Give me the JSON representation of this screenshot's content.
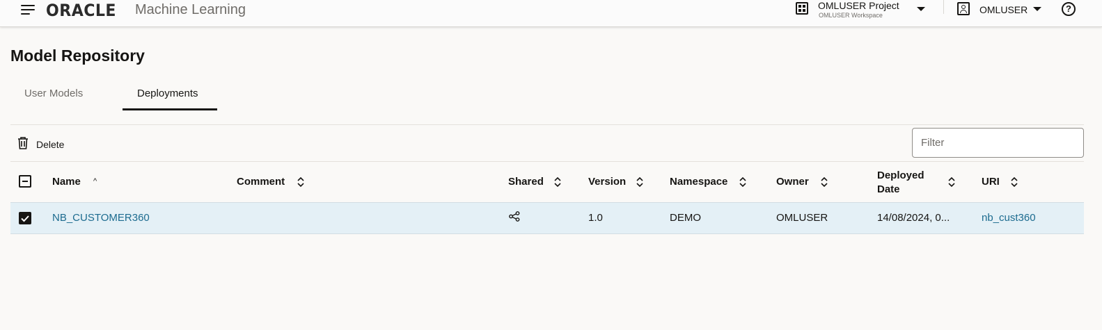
{
  "header": {
    "logo": "ORACLE",
    "app_name": "Machine Learning",
    "project_title": "OMLUSER Project",
    "project_subtitle": "OMLUSER Workspace",
    "user_name": "OMLUSER",
    "help_label": "?"
  },
  "page": {
    "title": "Model Repository",
    "tabs": [
      {
        "label": "User Models",
        "selected": false
      },
      {
        "label": "Deployments",
        "selected": true
      }
    ]
  },
  "toolbar": {
    "delete_label": "Delete",
    "filter_placeholder": "Filter",
    "filter_value": ""
  },
  "table": {
    "columns": [
      {
        "label": "Name",
        "sort": "ascending"
      },
      {
        "label": "Comment",
        "sort": "none"
      },
      {
        "label": "Shared",
        "sort": "none"
      },
      {
        "label": "Version",
        "sort": "none"
      },
      {
        "label": "Namespace",
        "sort": "none"
      },
      {
        "label": "Owner",
        "sort": "none"
      },
      {
        "label": "Deployed Date",
        "line1": "Deployed",
        "line2": "Date",
        "sort": "none"
      },
      {
        "label": "URI",
        "sort": "none"
      }
    ],
    "rows": [
      {
        "selected": true,
        "name": "NB_CUSTOMER360",
        "comment": "",
        "shared_icon": "share-icon",
        "version": "1.0",
        "namespace": "DEMO",
        "owner": "OMLUSER",
        "deployed_date": "14/08/2024, 0...",
        "uri": "nb_cust360"
      }
    ]
  },
  "colors": {
    "link": "#1c6b8f",
    "selected_row": "#e4f0f6",
    "text": "#161513",
    "muted": "#6f6c68"
  }
}
